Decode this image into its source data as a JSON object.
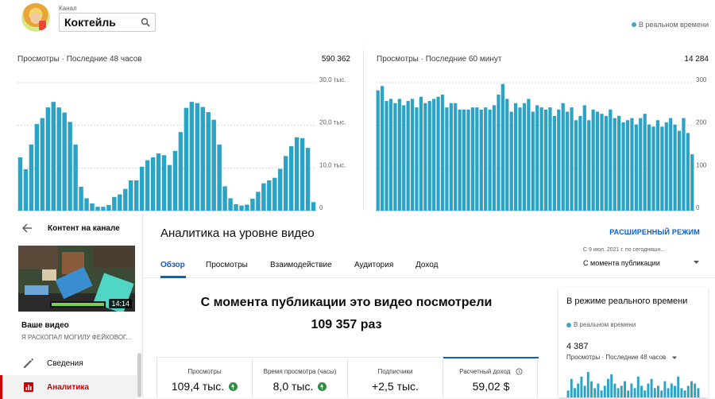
{
  "header": {
    "channel_label": "Канал",
    "channel_name": "Коктейль",
    "realtime_label": "В реальном времени"
  },
  "colors": {
    "bar": "#2ba3c6",
    "accent": "#065fd4",
    "active": "#cc0000",
    "up": "#2f8d45"
  },
  "chart_data": [
    {
      "type": "bar",
      "title": "Просмотры · Последние 48 часов",
      "total": "590 362",
      "ytick_labels": [
        "30,0 тыс.",
        "20,0 тыс.",
        "10,0 тыс.",
        "0"
      ],
      "yticks": [
        30000,
        20000,
        10000,
        0
      ],
      "ylim": [
        0,
        30000
      ],
      "values": [
        12500,
        9700,
        15500,
        20300,
        21700,
        24200,
        25500,
        24200,
        23000,
        20800,
        15500,
        5600,
        2900,
        1700,
        900,
        900,
        1300,
        3200,
        3800,
        5100,
        7100,
        7100,
        10300,
        11800,
        12500,
        13400,
        13000,
        10700,
        14000,
        18400,
        24100,
        25500,
        25200,
        24300,
        23100,
        21300,
        15500,
        5700,
        2900,
        1500,
        1200,
        1400,
        2800,
        4400,
        6400,
        7100,
        7700,
        9800,
        12800,
        15100,
        17200,
        17000,
        14700,
        2000
      ]
    },
    {
      "type": "bar",
      "title": "Просмотры · Последние 60 минут",
      "total": "14 284",
      "ytick_labels": [
        "300",
        "200",
        "100",
        "0"
      ],
      "yticks": [
        300,
        200,
        100,
        0
      ],
      "ylim": [
        0,
        300
      ],
      "values": [
        282,
        292,
        257,
        262,
        252,
        262,
        247,
        257,
        262,
        242,
        267,
        252,
        257,
        262,
        267,
        272,
        242,
        252,
        252,
        237,
        237,
        237,
        242,
        242,
        237,
        242,
        237,
        247,
        272,
        297,
        262,
        232,
        252,
        242,
        252,
        262,
        232,
        247,
        242,
        237,
        242,
        222,
        237,
        252,
        232,
        242,
        212,
        222,
        247,
        212,
        237,
        232,
        227,
        222,
        237,
        217,
        222,
        207,
        212,
        217,
        202,
        217,
        227,
        202,
        197,
        212,
        197,
        207,
        217,
        202,
        187,
        217,
        182,
        132
      ]
    },
    {
      "type": "bar",
      "title": "Просмотры · Последние 48 часов",
      "values": [
        3,
        8,
        4,
        6,
        9,
        5,
        11,
        7,
        4,
        6,
        3,
        5,
        8,
        10,
        6,
        4,
        5,
        7,
        3,
        6,
        4,
        9,
        5,
        3,
        6,
        8,
        4,
        5,
        3,
        7,
        4,
        6,
        5,
        9,
        4,
        3,
        5,
        7,
        6,
        4
      ]
    }
  ],
  "sidebar": {
    "header": "Контент на канале",
    "thumb_duration": "14:14",
    "your_video": "Ваше видео",
    "video_title": "Я РАСКОПАЛ МОГИЛУ ФЕЙКОВОГ...",
    "items": [
      {
        "label": "Сведения"
      },
      {
        "label": "Аналитика"
      }
    ]
  },
  "main": {
    "title": "Аналитика на уровне видео",
    "advanced_mode": "РАСШИРЕННЫЙ РЕЖИМ",
    "tabs": [
      {
        "label": "Обзор"
      },
      {
        "label": "Просмотры"
      },
      {
        "label": "Взаимодействие"
      },
      {
        "label": "Аудитория"
      },
      {
        "label": "Доход"
      }
    ],
    "date_range_label": "С 9 июл. 2021 г. по сегодняшн...",
    "date_range_value": "С момента публикации",
    "headline_line1": "С момента публикации это видео посмотрели",
    "headline_line2": "109 357 раз",
    "stats": [
      {
        "label": "Просмотры",
        "value": "109,4 тыс.",
        "trend": "up"
      },
      {
        "label": "Время просмотра (часы)",
        "value": "8,0 тыс.",
        "trend": "up"
      },
      {
        "label": "Подписчики",
        "value": "+2,5 тыс.",
        "trend": ""
      },
      {
        "label": "Расчетный доход",
        "value": "59,02 $",
        "trend": ""
      }
    ]
  },
  "realtime_card": {
    "title": "В режиме реального времени",
    "live_label": "В реальном времени",
    "count": "4 387",
    "period": "Просмотры · Последние 48 часов"
  }
}
